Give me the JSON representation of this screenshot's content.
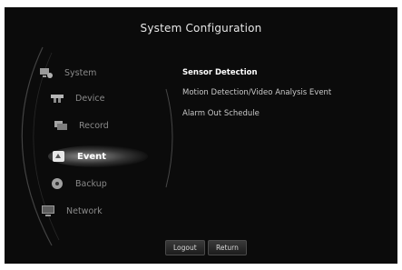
{
  "window": {
    "title": "System Configuration"
  },
  "nav": [
    {
      "label": "System",
      "icon": "system-icon",
      "active": false
    },
    {
      "label": "Device",
      "icon": "device-icon",
      "active": false
    },
    {
      "label": "Record",
      "icon": "record-icon",
      "active": false
    },
    {
      "label": "Event",
      "icon": "event-icon",
      "active": true
    },
    {
      "label": "Backup",
      "icon": "backup-icon",
      "active": false
    },
    {
      "label": "Network",
      "icon": "network-icon",
      "active": false
    }
  ],
  "submenu": {
    "items": [
      {
        "label": "Sensor Detection",
        "selected": true
      },
      {
        "label": "Motion Detection/Video Analysis Event",
        "selected": false
      },
      {
        "label": "Alarm Out Schedule",
        "selected": false
      }
    ]
  },
  "footer": {
    "logout_label": "Logout",
    "return_label": "Return"
  },
  "colors": {
    "background": "#0b0b0b",
    "text": "#c8c8c8",
    "inactive_nav": "#8a8a8a",
    "active": "#ffffff"
  }
}
